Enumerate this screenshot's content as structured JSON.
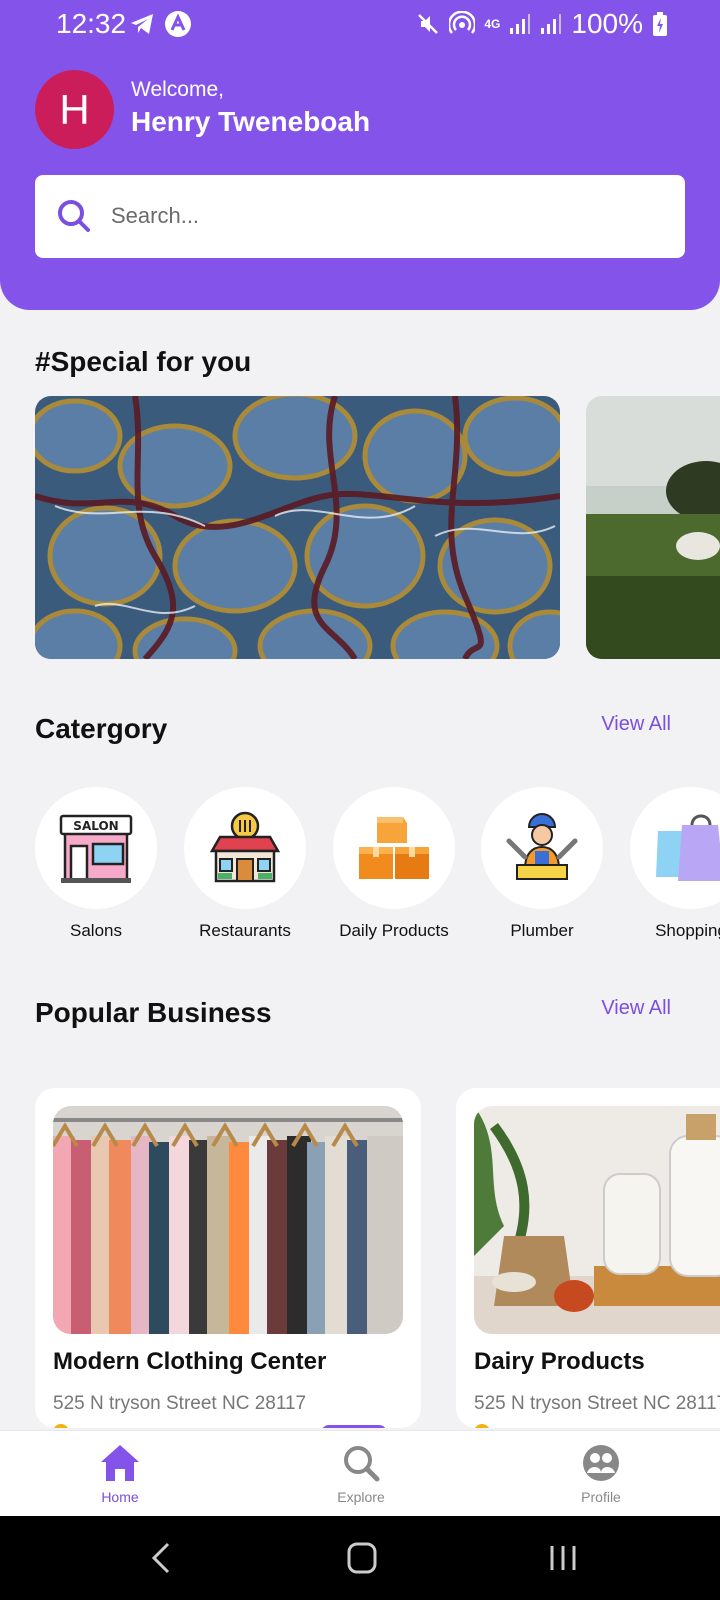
{
  "status_bar": {
    "time": "12:32",
    "network": "4G",
    "battery": "100%"
  },
  "user": {
    "initial": "H",
    "welcome": "Welcome,",
    "name": "Henry Tweneboah"
  },
  "search": {
    "placeholder": "Search..."
  },
  "special": {
    "title": "#Special for you"
  },
  "categories": {
    "title": "Catergory",
    "view_all": "View All",
    "items": [
      {
        "label": "Salons",
        "icon": "salon-icon",
        "sign": "SALON"
      },
      {
        "label": "Restaurants",
        "icon": "restaurant-icon"
      },
      {
        "label": "Daily Products",
        "icon": "boxes-icon"
      },
      {
        "label": "Plumber",
        "icon": "plumber-icon"
      },
      {
        "label": "Shopping",
        "icon": "shopping-bags-icon"
      }
    ]
  },
  "popular": {
    "title": "Popular Business",
    "view_all": "View All",
    "items": [
      {
        "name": "Modern Clothing Center",
        "address": "525 N tryson Street NC 28117"
      },
      {
        "name": "Dairy Products",
        "address": "525 N tryson Street NC 28117"
      }
    ]
  },
  "bottom_nav": {
    "items": [
      {
        "label": "Home",
        "icon": "home-icon",
        "active": true
      },
      {
        "label": "Explore",
        "icon": "search-icon",
        "active": false
      },
      {
        "label": "Profile",
        "icon": "profile-icon",
        "active": false
      }
    ]
  },
  "colors": {
    "primary": "#8454ea",
    "avatar": "#cc1d5b",
    "background": "#f2f1f3",
    "link": "#7a4fe0"
  }
}
